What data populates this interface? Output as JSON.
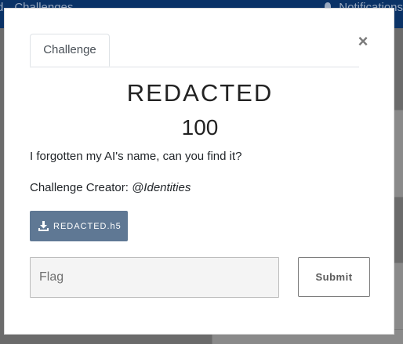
{
  "background": {
    "nav_left": [
      "d",
      "Challenges"
    ],
    "nav_right_label": "Notifications"
  },
  "modal": {
    "tab_label": "Challenge",
    "close_label": "×",
    "title": "REDACTED",
    "value": "100",
    "description": "I forgotten my AI's name, can you find it?",
    "creator_prefix": "Challenge Creator: ",
    "creator_name": "@Identities",
    "file_label": "REDACTED.h5",
    "flag_placeholder": "Flag",
    "flag_value": "",
    "submit_label": "Submit"
  },
  "colors": {
    "navbar": "#0a3266",
    "file_button": "#5f7894",
    "overlay": "#6b6b6b"
  }
}
